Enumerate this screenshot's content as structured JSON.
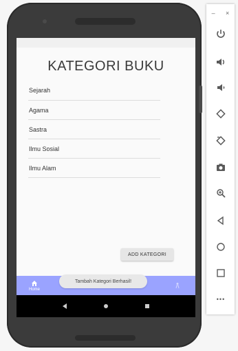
{
  "screen": {
    "title": "KATEGORI BUKU",
    "categories": [
      "Sejarah",
      "Agama",
      "Sastra",
      "Ilmu Sosial",
      "Ilmu Alam"
    ],
    "add_button_label": "ADD KATEGORI",
    "toast_message": "Tambah Kategori Berhasil!",
    "bottom_nav": {
      "home_label": "Home",
      "accent_color": "#9aa3ff"
    }
  },
  "emulator_toolbar": {
    "minimize_label": "–",
    "close_label": "×",
    "more_label": "•••",
    "icons": [
      "power-icon",
      "volume-up-icon",
      "volume-down-icon",
      "rotate-left-icon",
      "rotate-right-icon",
      "camera-icon",
      "zoom-icon",
      "back-icon",
      "home-icon",
      "overview-icon",
      "more-icon"
    ]
  }
}
